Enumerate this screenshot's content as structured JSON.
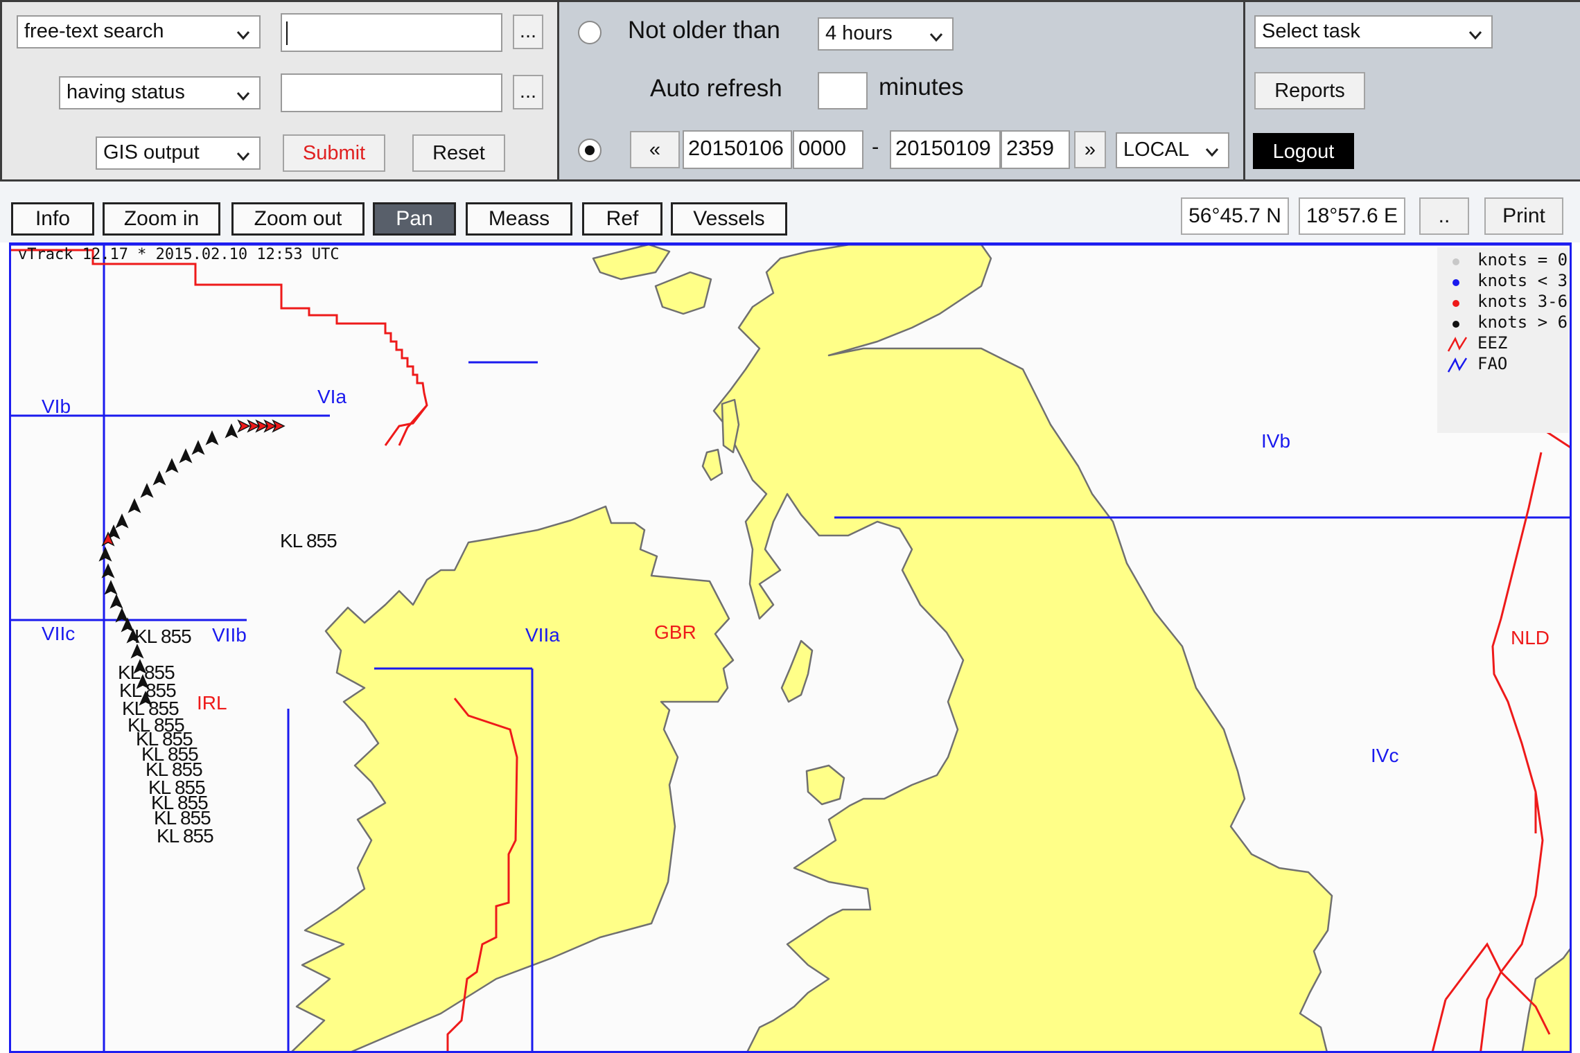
{
  "search": {
    "mode": "free-text search",
    "query": "",
    "status_filter_label": "having status",
    "status_value": "",
    "output": "GIS output",
    "more": "...",
    "submit": "Submit",
    "reset": "Reset"
  },
  "time": {
    "not_older_label": "Not older than",
    "not_older_value": "4 hours",
    "auto_refresh_label": "Auto refresh",
    "auto_refresh_value": "",
    "minutes_label": "minutes",
    "prev": "«",
    "next": "»",
    "from_date": "20150106",
    "from_time": "0000",
    "dash": "-",
    "to_date": "20150109",
    "to_time": "2359",
    "timezone": "LOCAL",
    "mode_selected": "range"
  },
  "task": {
    "select": "Select task",
    "reports": "Reports",
    "logout": "Logout"
  },
  "toolbar": {
    "buttons": [
      "Info",
      "Zoom in",
      "Zoom out",
      "Pan",
      "Meass",
      "Ref",
      "Vessels"
    ],
    "active": "Pan",
    "lat": "56°45.7 N",
    "lon": "18°57.6 E",
    "dots": "..",
    "print": "Print"
  },
  "map": {
    "stamp": "vTrack 12.17 * 2015.02.10 12:53 UTC",
    "fao_areas": [
      "VIb",
      "VIa",
      "IVb",
      "VIIc",
      "VIIb",
      "VIIa",
      "IVc"
    ],
    "eez_labels": [
      "GBR",
      "IRL",
      "NLD"
    ],
    "vessel_label": "KL 855",
    "legend": [
      {
        "label": "knots = 0",
        "color": "#c8c8c8"
      },
      {
        "label": "knots < 3",
        "color": "#1a1aee"
      },
      {
        "label": "knots 3-6",
        "color": "#ee1a1a"
      },
      {
        "label": "knots > 6",
        "color": "#111111"
      },
      {
        "label": "EEZ",
        "color": "#ee1a1a",
        "icon": "eez-line-icon"
      },
      {
        "label": "FAO",
        "color": "#1a1aee",
        "icon": "fao-line-icon"
      }
    ],
    "colors": {
      "land": "#ffff88",
      "coast": "#707070",
      "eez": "#ee1a1a",
      "fao": "#1a1aee",
      "water": "#fbfbfb"
    }
  }
}
